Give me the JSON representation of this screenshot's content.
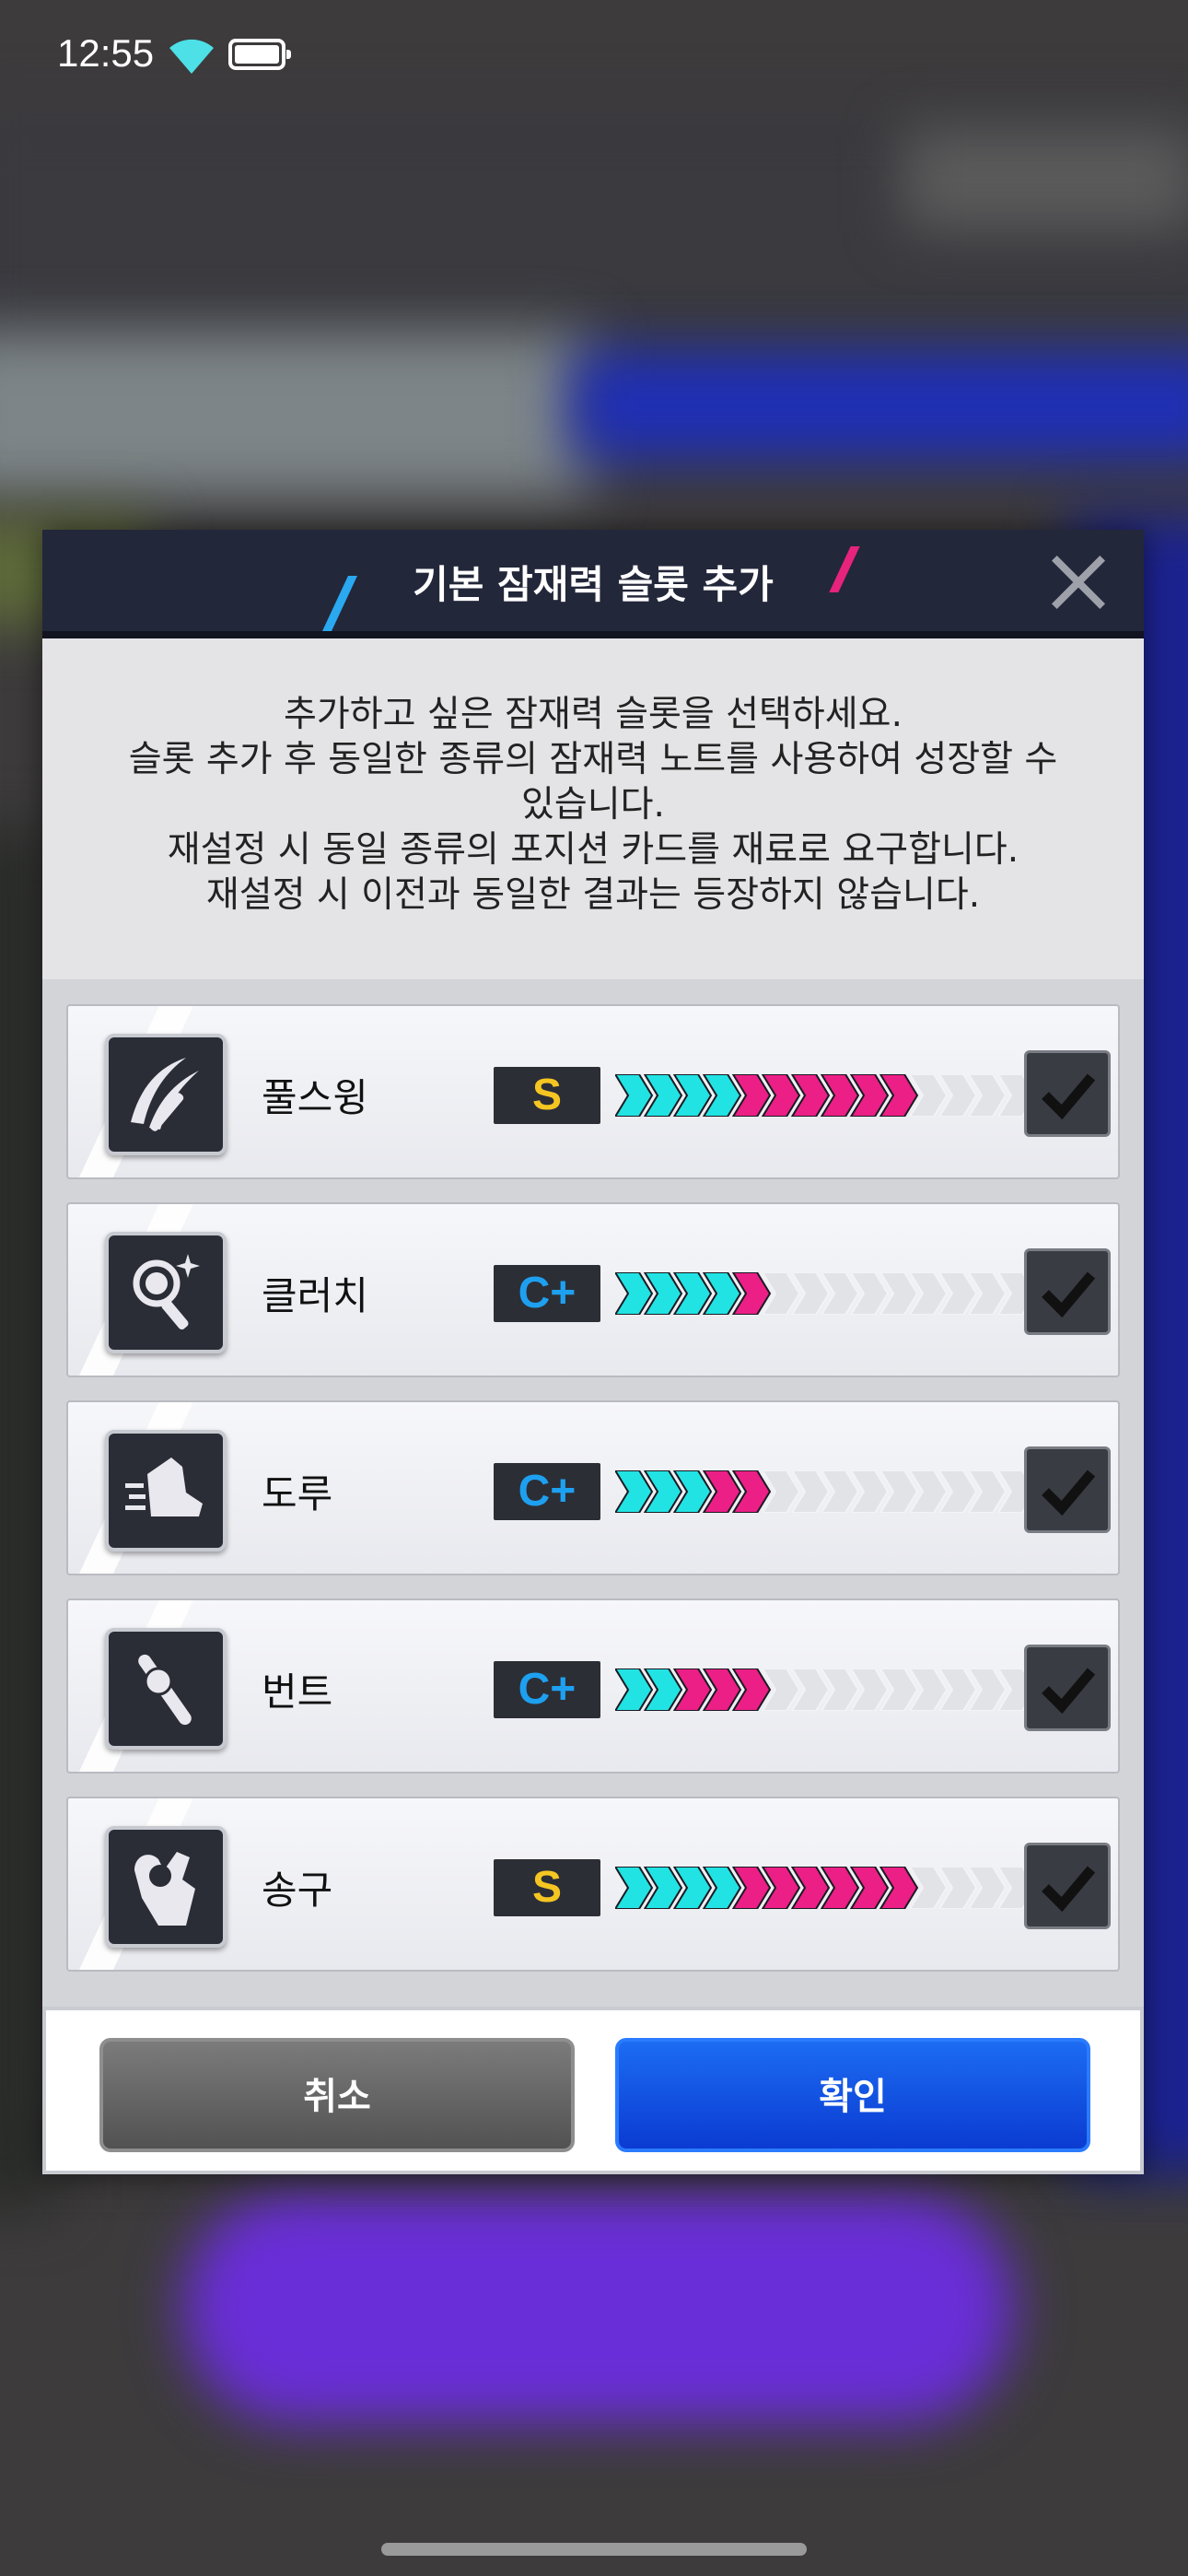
{
  "status_bar": {
    "time": "12:55"
  },
  "dialog": {
    "title": "기본 잠재력 슬롯 추가",
    "description": [
      "추가하고 싶은 잠재력 슬롯을 선택하세요.",
      "슬롯 추가 후 동일한 종류의 잠재력 노트를 사용하여 성장할 수",
      "있습니다.",
      "재설정 시 동일 종류의 포지션 카드를 재료로 요구합니다.",
      "재설정 시 이전과 동일한 결과는 등장하지 않습니다."
    ],
    "slots": [
      {
        "label": "풀스윙",
        "icon": "swing-icon",
        "grade": "S",
        "cyan": 4,
        "pink": 6,
        "total": 14,
        "checked": true
      },
      {
        "label": "클러치",
        "icon": "clutch-icon",
        "grade": "C+",
        "cyan": 4,
        "pink": 1,
        "total": 14,
        "checked": true
      },
      {
        "label": "도루",
        "icon": "steal-icon",
        "grade": "C+",
        "cyan": 3,
        "pink": 2,
        "total": 14,
        "checked": true
      },
      {
        "label": "번트",
        "icon": "bunt-icon",
        "grade": "C+",
        "cyan": 2,
        "pink": 3,
        "total": 14,
        "checked": true
      },
      {
        "label": "송구",
        "icon": "throw-icon",
        "grade": "S",
        "cyan": 4,
        "pink": 6,
        "total": 14,
        "checked": true
      }
    ],
    "cancel_label": "취소",
    "confirm_label": "확인"
  },
  "colors": {
    "cyan": "#22e3e3",
    "pink": "#ec1f86",
    "empty": "#e2e3e7",
    "grade_s": "#f5c622",
    "grade_c": "#1ea0f0",
    "confirm": "#0b4ce6"
  }
}
